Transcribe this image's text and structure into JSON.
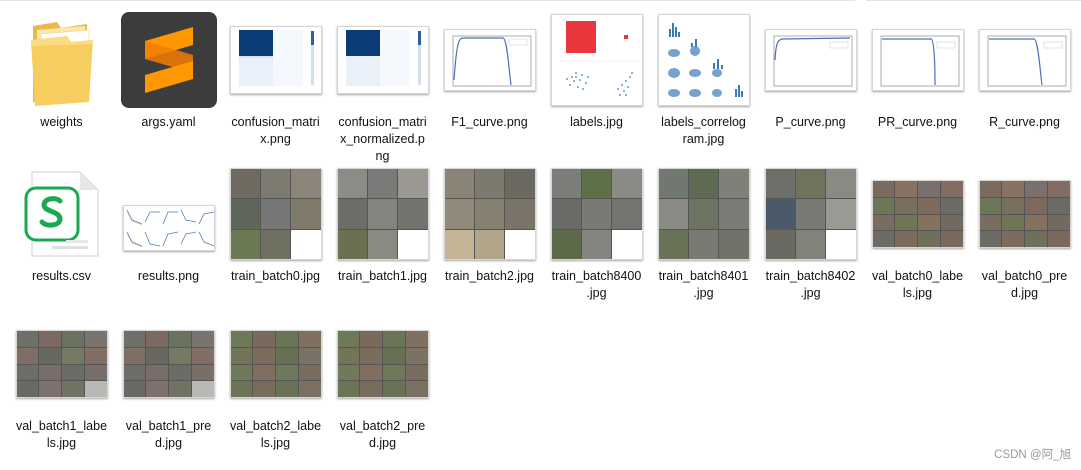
{
  "files": [
    {
      "name": "weights",
      "lines": [
        "weights"
      ],
      "icon": "folder-icon"
    },
    {
      "name": "args.yaml",
      "lines": [
        "args.yaml"
      ],
      "icon": "sublime-text-icon"
    },
    {
      "name": "confusion_matrix.png",
      "lines": [
        "confusion_matri",
        "x.png"
      ],
      "icon": "confusion-matrix-thumbnail"
    },
    {
      "name": "confusion_matrix_normalized.png",
      "lines": [
        "confusion_matri",
        "x_normalized.p",
        "ng"
      ],
      "icon": "confusion-matrix-normalized-thumbnail"
    },
    {
      "name": "F1_curve.png",
      "lines": [
        "F1_curve.png"
      ],
      "icon": "curve-thumbnail"
    },
    {
      "name": "labels.jpg",
      "lines": [
        "labels.jpg"
      ],
      "icon": "labels-thumbnail"
    },
    {
      "name": "labels_correlogram.jpg",
      "lines": [
        "labels_correlog",
        "ram.jpg"
      ],
      "icon": "correlogram-thumbnail"
    },
    {
      "name": "P_curve.png",
      "lines": [
        "P_curve.png"
      ],
      "icon": "curve-thumbnail"
    },
    {
      "name": "PR_curve.png",
      "lines": [
        "PR_curve.png"
      ],
      "icon": "curve-thumbnail"
    },
    {
      "name": "R_curve.png",
      "lines": [
        "R_curve.png"
      ],
      "icon": "curve-thumbnail"
    },
    {
      "name": "results.csv",
      "lines": [
        "results.csv"
      ],
      "icon": "spreadsheet-file-icon"
    },
    {
      "name": "results.png",
      "lines": [
        "results.png"
      ],
      "icon": "results-plots-thumbnail"
    },
    {
      "name": "train_batch0.jpg",
      "lines": [
        "train_batch0.jpg"
      ],
      "icon": "image-mosaic-thumbnail"
    },
    {
      "name": "train_batch1.jpg",
      "lines": [
        "train_batch1.jpg"
      ],
      "icon": "image-mosaic-thumbnail"
    },
    {
      "name": "train_batch2.jpg",
      "lines": [
        "train_batch2.jpg"
      ],
      "icon": "image-mosaic-thumbnail"
    },
    {
      "name": "train_batch8400.jpg",
      "lines": [
        "train_batch8400",
        ".jpg"
      ],
      "icon": "image-mosaic-thumbnail"
    },
    {
      "name": "train_batch8401.jpg",
      "lines": [
        "train_batch8401",
        ".jpg"
      ],
      "icon": "image-mosaic-thumbnail"
    },
    {
      "name": "train_batch8402.jpg",
      "lines": [
        "train_batch8402",
        ".jpg"
      ],
      "icon": "image-mosaic-thumbnail"
    },
    {
      "name": "val_batch0_labels.jpg",
      "lines": [
        "val_batch0_labe",
        "ls.jpg"
      ],
      "icon": "image-mosaic-thumbnail"
    },
    {
      "name": "val_batch0_pred.jpg",
      "lines": [
        "val_batch0_pre",
        "d.jpg"
      ],
      "icon": "image-mosaic-thumbnail"
    },
    {
      "name": "val_batch1_labels.jpg",
      "lines": [
        "val_batch1_labe",
        "ls.jpg"
      ],
      "icon": "image-mosaic-thumbnail"
    },
    {
      "name": "val_batch1_pred.jpg",
      "lines": [
        "val_batch1_pre",
        "d.jpg"
      ],
      "icon": "image-mosaic-thumbnail"
    },
    {
      "name": "val_batch2_labels.jpg",
      "lines": [
        "val_batch2_labe",
        "ls.jpg"
      ],
      "icon": "image-mosaic-thumbnail"
    },
    {
      "name": "val_batch2_pred.jpg",
      "lines": [
        "val_batch2_pre",
        "d.jpg"
      ],
      "icon": "image-mosaic-thumbnail"
    }
  ],
  "watermark": "CSDN @阿_旭",
  "colors": {
    "folder": "#f6cd5f",
    "sublime_bg": "#3c3c3c",
    "sublime_logo": "#ff9800",
    "csv_green": "#1aa851",
    "confusion_blue": "#0b3c78",
    "labels_red": "#e8363c",
    "scatter_blue": "#3d7ab8"
  }
}
